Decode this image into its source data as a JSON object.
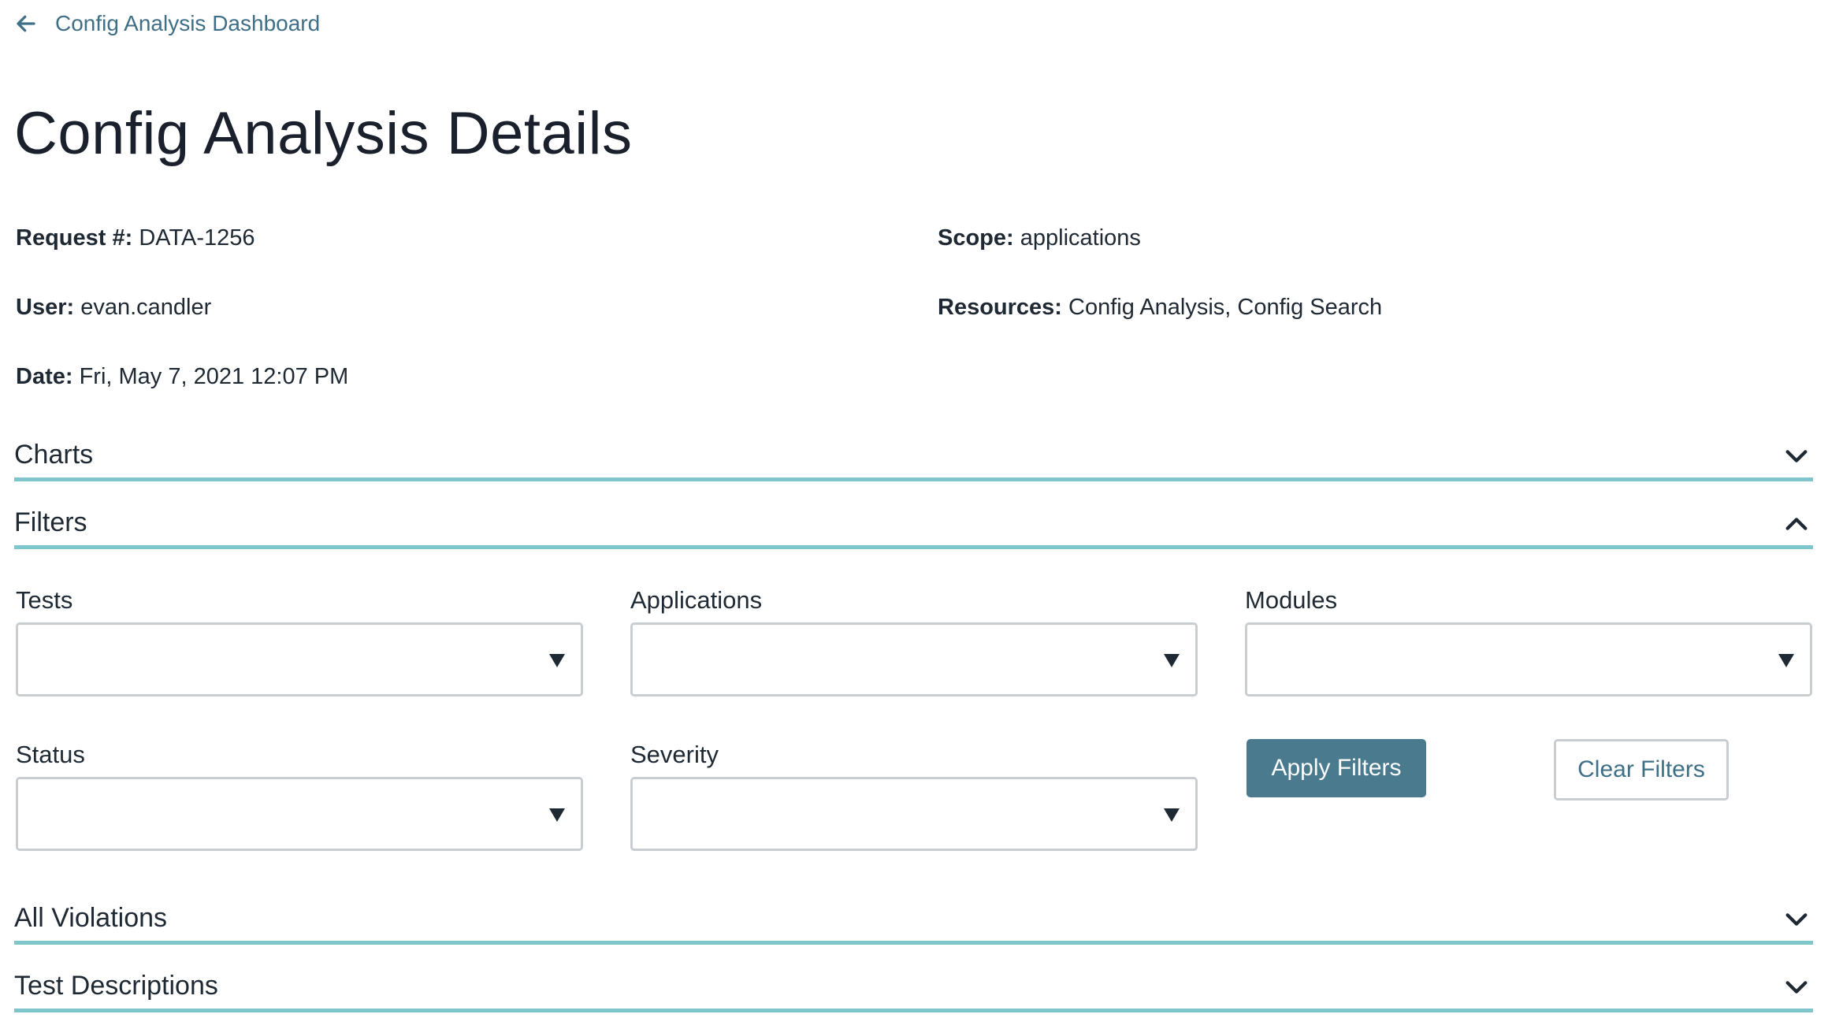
{
  "nav": {
    "back_label": "Config Analysis Dashboard"
  },
  "page": {
    "title": "Config Analysis Details"
  },
  "meta": {
    "request": {
      "label": "Request #:",
      "value": "DATA-1256"
    },
    "user": {
      "label": "User:",
      "value": "evan.candler"
    },
    "date": {
      "label": "Date:",
      "value": "Fri, May 7, 2021 12:07 PM"
    },
    "scope": {
      "label": "Scope:",
      "value": "applications"
    },
    "resources": {
      "label": "Resources:",
      "value": "Config Analysis, Config Search"
    }
  },
  "sections": {
    "charts": {
      "title": "Charts",
      "expanded": false
    },
    "filters": {
      "title": "Filters",
      "expanded": true
    },
    "violations": {
      "title": "All Violations",
      "expanded": false
    },
    "descriptions": {
      "title": "Test Descriptions",
      "expanded": false
    }
  },
  "filters": {
    "tests": {
      "label": "Tests",
      "value": ""
    },
    "applications": {
      "label": "Applications",
      "value": ""
    },
    "modules": {
      "label": "Modules",
      "value": ""
    },
    "status": {
      "label": "Status",
      "value": ""
    },
    "severity": {
      "label": "Severity",
      "value": ""
    },
    "apply_label": "Apply Filters",
    "clear_label": "Clear Filters"
  },
  "colors": {
    "accent": "#7fc6cc",
    "primary_button": "#4a7a8e",
    "link": "#3f6f86"
  }
}
